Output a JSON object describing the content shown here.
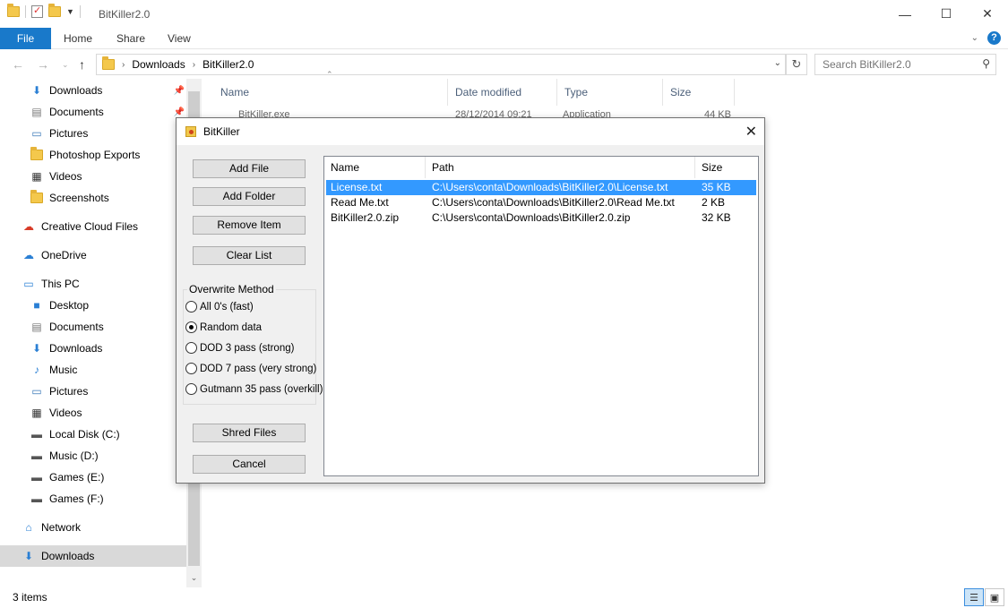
{
  "explorer": {
    "title": "BitKiller2.0",
    "tabs": [
      "File",
      "Home",
      "Share",
      "View"
    ],
    "breadcrumb": [
      "Downloads",
      "BitKiller2.0"
    ],
    "search_placeholder": "Search BitKiller2.0",
    "columns": [
      "Name",
      "Date modified",
      "Type",
      "Size"
    ],
    "partial_row": {
      "name": "BitKiller.exe",
      "date": "28/12/2014 09:21",
      "type": "Application",
      "size": "44 KB"
    },
    "status": "3 items",
    "nav": [
      {
        "label": "Downloads",
        "icon": "download-icon",
        "pinned": true
      },
      {
        "label": "Documents",
        "icon": "documents-icon",
        "pinned": true
      },
      {
        "label": "Pictures",
        "icon": "pictures-icon",
        "pinned": false
      },
      {
        "label": "Photoshop Exports",
        "icon": "folder-icon",
        "pinned": false
      },
      {
        "label": "Videos",
        "icon": "videos-icon",
        "pinned": false
      },
      {
        "label": "Screenshots",
        "icon": "folder-icon",
        "pinned": false
      },
      {
        "label": "Creative Cloud Files",
        "icon": "creative-cloud-icon",
        "pinned": false
      },
      {
        "label": "OneDrive",
        "icon": "onedrive-icon",
        "pinned": false
      },
      {
        "label": "This PC",
        "icon": "pc-icon",
        "pinned": false
      },
      {
        "label": "Desktop",
        "icon": "desktop-icon",
        "pinned": false
      },
      {
        "label": "Documents",
        "icon": "documents-icon",
        "pinned": false
      },
      {
        "label": "Downloads",
        "icon": "download-icon",
        "pinned": false
      },
      {
        "label": "Music",
        "icon": "music-icon",
        "pinned": false
      },
      {
        "label": "Pictures",
        "icon": "pictures-icon",
        "pinned": false
      },
      {
        "label": "Videos",
        "icon": "videos-icon",
        "pinned": false
      },
      {
        "label": "Local Disk (C:)",
        "icon": "drive-icon",
        "pinned": false
      },
      {
        "label": "Music (D:)",
        "icon": "drive-icon",
        "pinned": false
      },
      {
        "label": "Games (E:)",
        "icon": "drive-icon",
        "pinned": false
      },
      {
        "label": "Games (F:)",
        "icon": "drive-icon",
        "pinned": false
      },
      {
        "label": "Network",
        "icon": "network-icon",
        "pinned": false
      },
      {
        "label": "Downloads",
        "icon": "download-icon",
        "pinned": false,
        "selected": true
      }
    ]
  },
  "dialog": {
    "title": "BitKiller",
    "buttons": {
      "add_file": "Add File",
      "add_folder": "Add Folder",
      "remove_item": "Remove Item",
      "clear_list": "Clear List",
      "shred_files": "Shred Files",
      "cancel": "Cancel"
    },
    "overwrite": {
      "legend": "Overwrite Method",
      "options": [
        {
          "label": "All 0's (fast)",
          "checked": false
        },
        {
          "label": "Random data",
          "checked": true
        },
        {
          "label": "DOD 3 pass (strong)",
          "checked": false
        },
        {
          "label": "DOD 7 pass (very strong)",
          "checked": false
        },
        {
          "label": "Gutmann 35 pass (overkill)",
          "checked": false
        }
      ]
    },
    "list": {
      "columns": [
        "Name",
        "Path",
        "Size"
      ],
      "rows": [
        {
          "name": "License.txt",
          "path": "C:\\Users\\conta\\Downloads\\BitKiller2.0\\License.txt",
          "size": "35 KB",
          "selected": true
        },
        {
          "name": "Read Me.txt",
          "path": "C:\\Users\\conta\\Downloads\\BitKiller2.0\\Read Me.txt",
          "size": "2 KB",
          "selected": false
        },
        {
          "name": "BitKiller2.0.zip",
          "path": "C:\\Users\\conta\\Downloads\\BitKiller2.0.zip",
          "size": "32 KB",
          "selected": false
        }
      ]
    }
  },
  "colors": {
    "accent": "#1979ca",
    "selection": "#3399ff",
    "nav_selected": "#d9d9d9"
  }
}
